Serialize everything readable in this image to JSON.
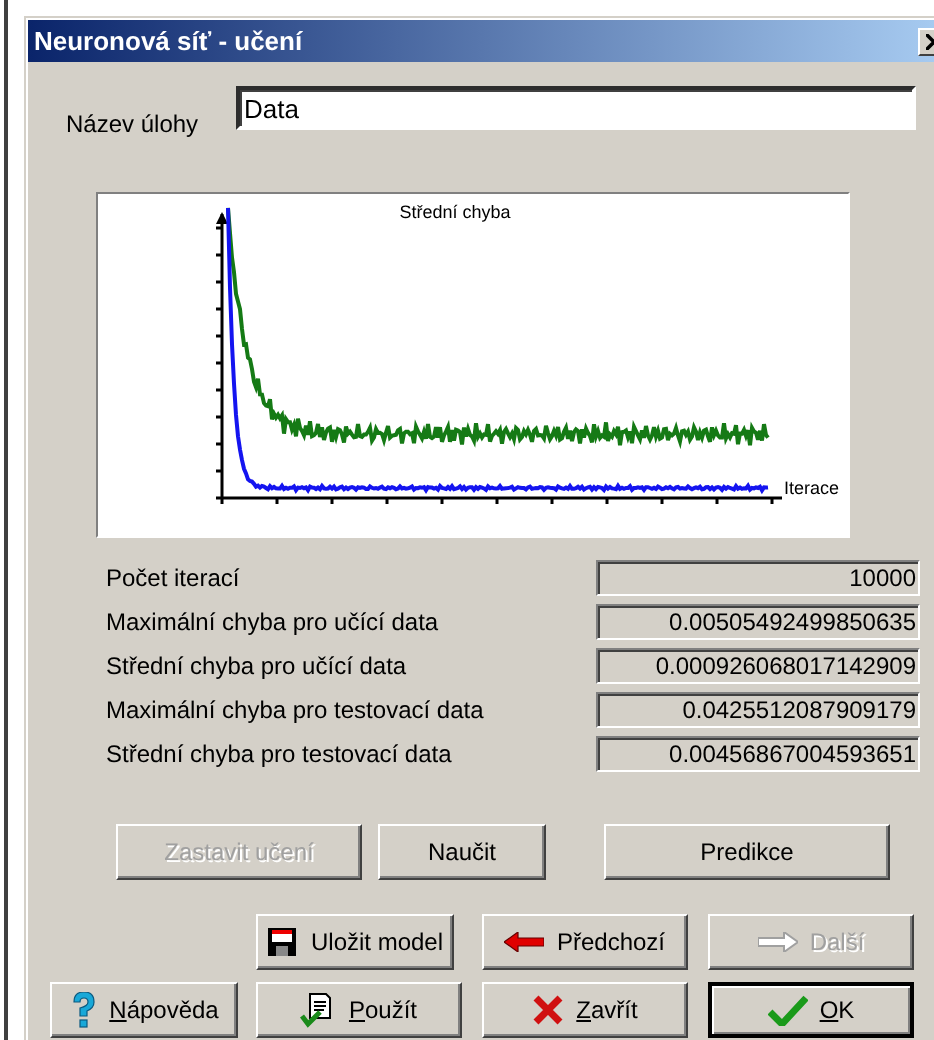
{
  "window": {
    "title": "Neuronová síť - učení"
  },
  "task_name": {
    "label": "Název úlohy",
    "value": "Data"
  },
  "chart": {
    "title": "Střední chyba",
    "xlabel": "Iterace"
  },
  "stats": [
    {
      "label": "Počet iterací",
      "value": "10000"
    },
    {
      "label": "Maximální chyba pro učící data",
      "value": "0.00505492499850635"
    },
    {
      "label": "Střední chyba pro učící data",
      "value": "0.000926068017142909"
    },
    {
      "label": "Maximální chyba pro testovací data",
      "value": "0.0425512087909179"
    },
    {
      "label": "Střední chyba pro testovací data",
      "value": "0.00456867004593651"
    }
  ],
  "button_rows": [
    {
      "buttons": [
        {
          "label": "Zastavit učení",
          "kind": "plain",
          "disabled": true,
          "default": false,
          "underline_first": false
        },
        {
          "label": "Naučit",
          "kind": "plain",
          "disabled": false,
          "default": false,
          "underline_first": false
        },
        {
          "label": "Predikce",
          "kind": "plain",
          "disabled": false,
          "default": false,
          "underline_first": false
        }
      ]
    },
    {
      "buttons": [
        {
          "label": "Uložit model",
          "kind": "save",
          "disabled": false,
          "default": false,
          "underline_first": false
        },
        {
          "label": "Předchozí",
          "kind": "back",
          "disabled": false,
          "default": false,
          "underline_first": false
        },
        {
          "label": "Další",
          "kind": "next",
          "disabled": true,
          "default": false,
          "underline_first": false
        }
      ]
    },
    {
      "buttons": [
        {
          "label": "Nápověda",
          "kind": "help",
          "disabled": false,
          "default": false,
          "underline_first": true
        },
        {
          "label": "Použít",
          "kind": "apply",
          "disabled": false,
          "default": false,
          "underline_first": true
        },
        {
          "label": "Zavřít",
          "kind": "close",
          "disabled": false,
          "default": false,
          "underline_first": true
        },
        {
          "label": "OK",
          "kind": "ok",
          "disabled": false,
          "default": true,
          "underline_first": true
        }
      ]
    }
  ]
}
